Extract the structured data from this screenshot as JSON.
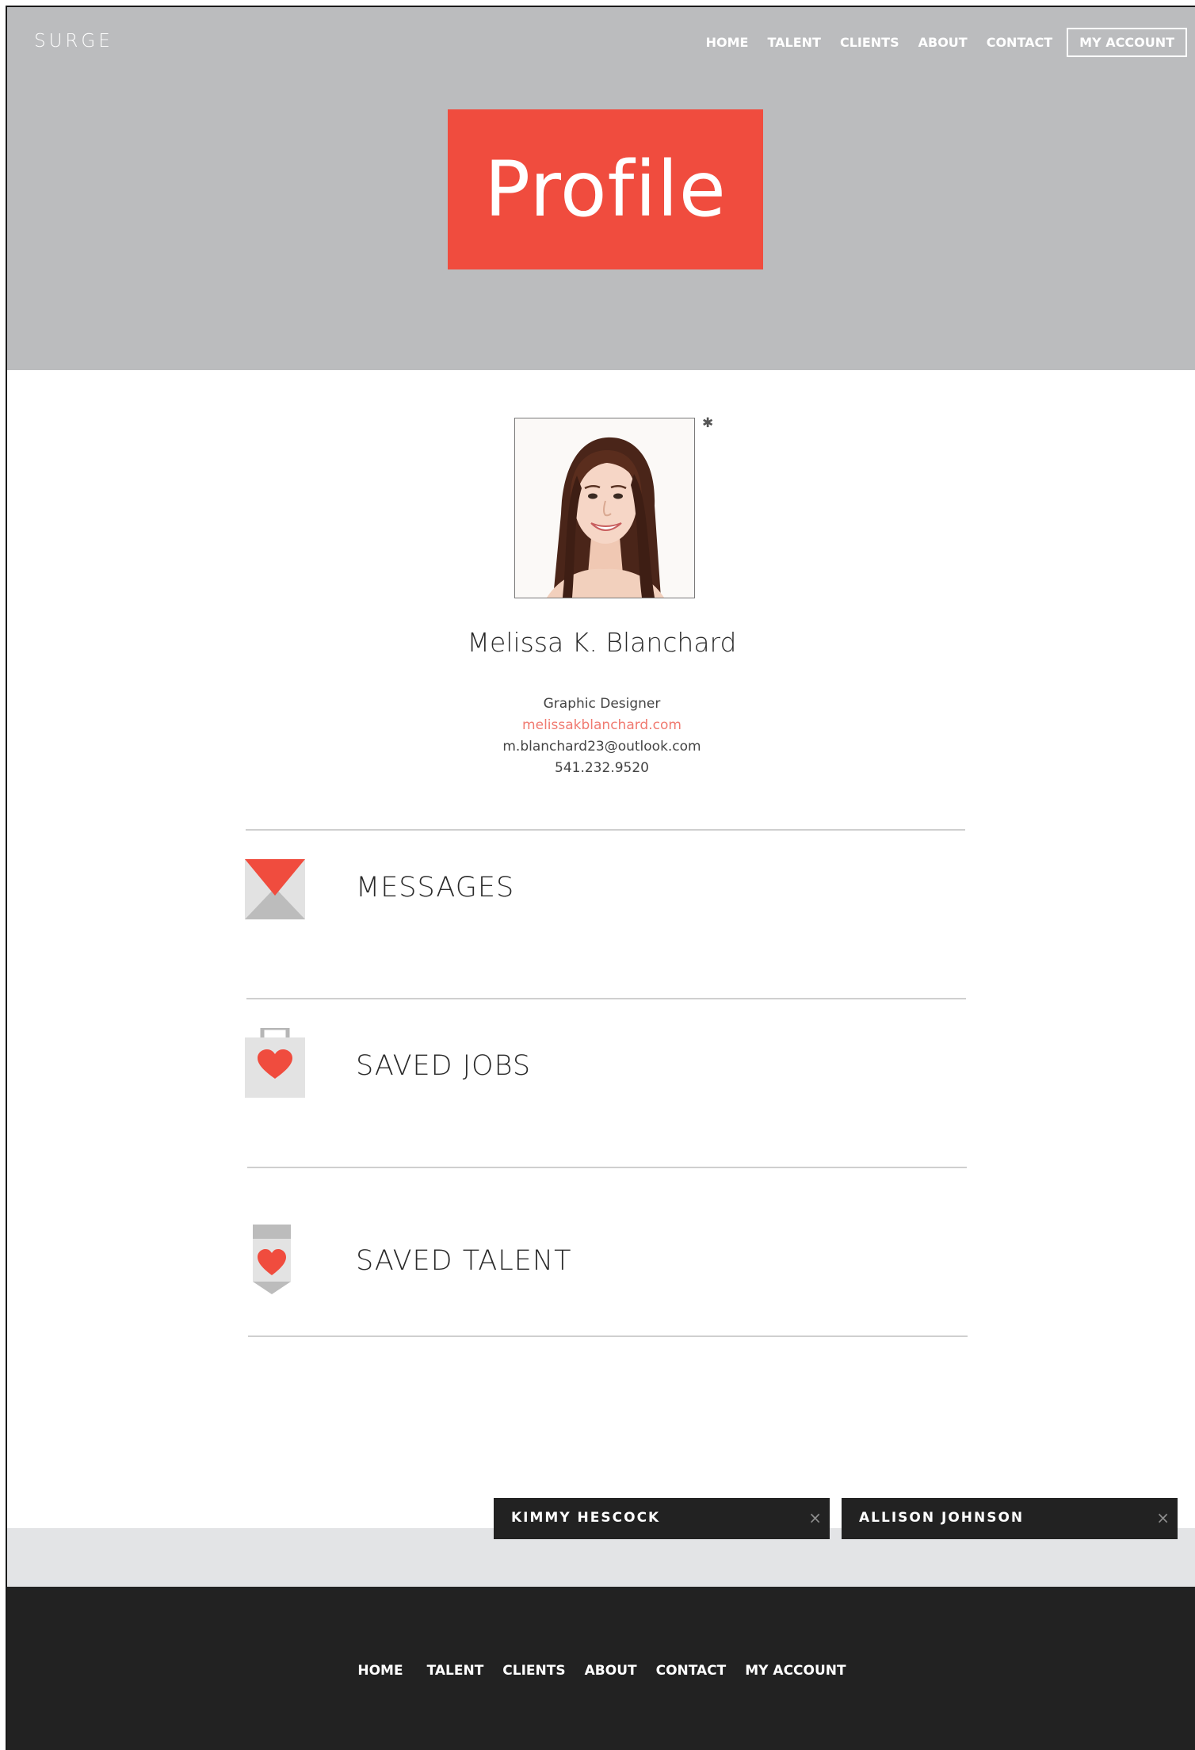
{
  "header": {
    "logo": "SURGE",
    "nav": [
      "HOME",
      "TALENT",
      "CLIENTS",
      "ABOUT",
      "CONTACT"
    ],
    "account_label": "MY ACCOUNT",
    "hero_title": "Profile",
    "hero_color": "#f04c3e"
  },
  "profile": {
    "name": "Melissa K. Blanchard",
    "title": "Graphic Designer",
    "website": "melissakblanchard.com",
    "email": "m.blanchard23@outlook.com",
    "phone": "541.232.9520"
  },
  "sections": [
    {
      "label": "MESSAGES",
      "icon": "envelope-icon"
    },
    {
      "label": "SAVED JOBS",
      "icon": "briefcase-heart-icon"
    },
    {
      "label": "SAVED TALENT",
      "icon": "badge-heart-icon"
    }
  ],
  "chats": [
    {
      "name": "KIMMY HESCOCK",
      "close": "×"
    },
    {
      "name": "ALLISON JOHNSON",
      "close": "×"
    }
  ],
  "footer": {
    "nav": [
      "HOME",
      "TALENT",
      "CLIENTS",
      "ABOUT",
      "CONTACT",
      "MY ACCOUNT"
    ]
  }
}
